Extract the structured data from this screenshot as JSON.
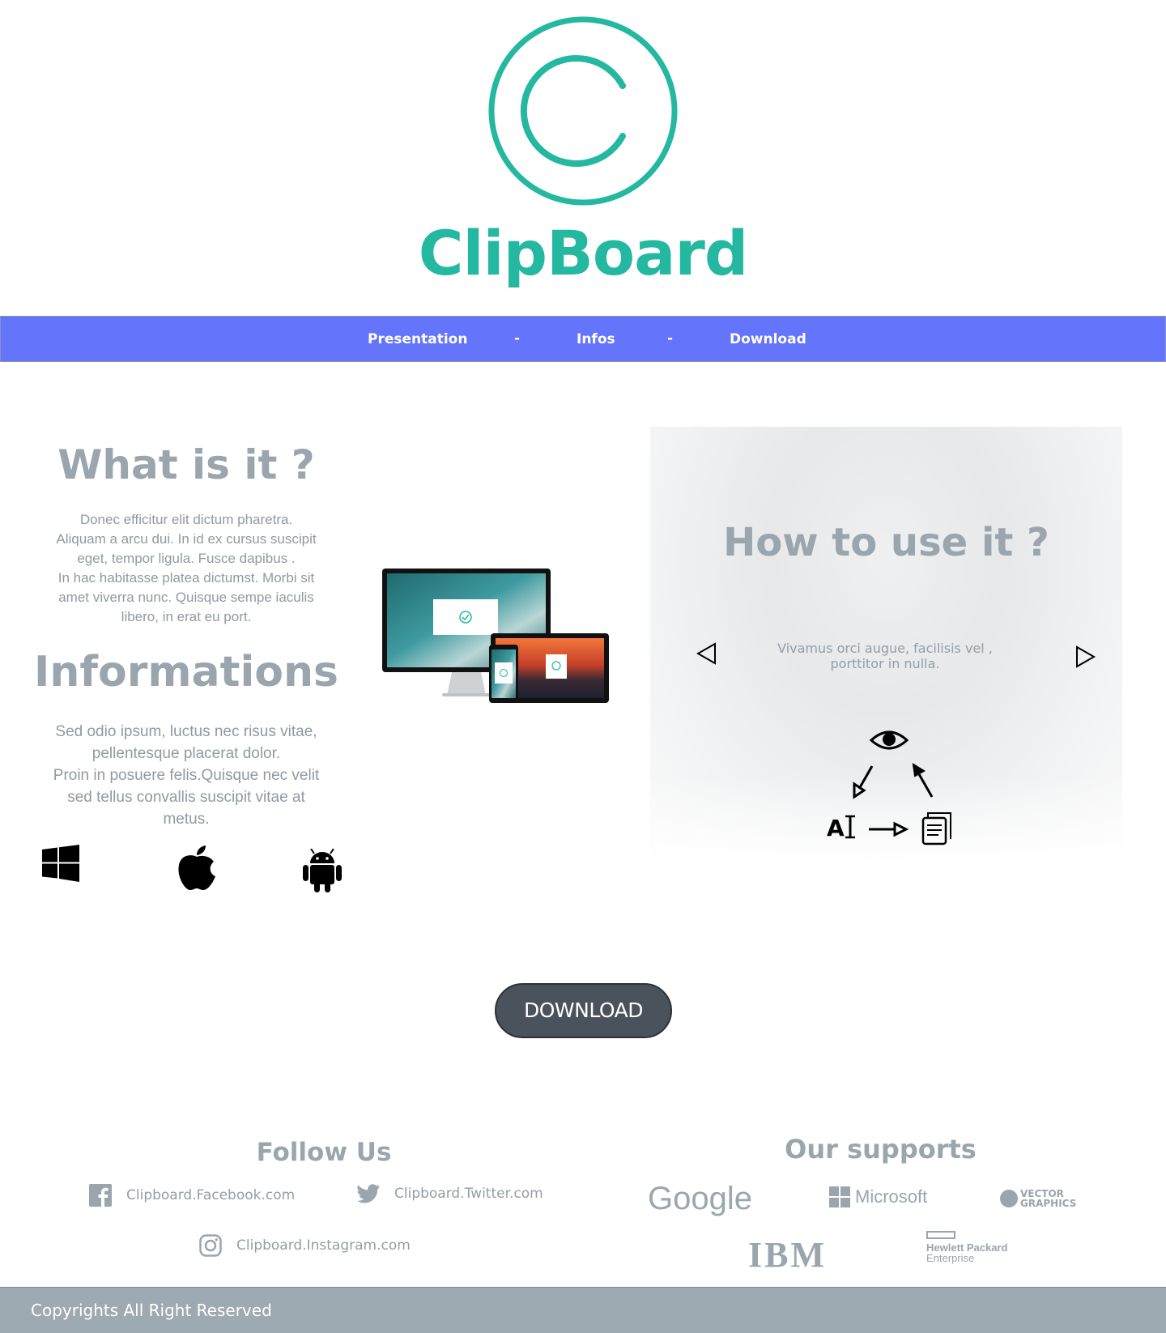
{
  "brand": {
    "name": "ClipBoard",
    "logo_icon": "copyright-icon",
    "color": "#24b8a0"
  },
  "nav": {
    "items": [
      {
        "label": "Presentation"
      },
      {
        "label": "Infos"
      },
      {
        "label": "Download"
      }
    ],
    "separator": "-",
    "background": "#6474fb"
  },
  "what": {
    "title": "What is it ?",
    "lines": [
      "Donec efficitur elit dictum pharetra.",
      "Aliquam a arcu dui. In id ex cursus suscipit",
      "eget, tempor ligula. Fusce dapibus .",
      "In hac habitasse platea dictumst. Morbi sit",
      "amet viverra nunc. Quisque sempe iaculis",
      "libero, in erat eu port."
    ]
  },
  "info": {
    "title": "Informations",
    "lines": [
      "Sed odio ipsum, luctus nec risus vitae,",
      "pellentesque placerat dolor.",
      "Proin in posuere felis.Quisque nec velit",
      "sed tellus convallis suscipit vitae at",
      "metus."
    ],
    "platforms": [
      "windows-icon",
      "apple-icon",
      "android-icon"
    ]
  },
  "how": {
    "title": "How to use it ?",
    "text_line1": "Vivamus orci augue, facilisis vel ,",
    "text_line2": "porttitor in nulla.",
    "flow_icons": [
      "eye-icon",
      "text-recognition-icon",
      "document-icon"
    ]
  },
  "download_button": {
    "label": "DOWNLOAD"
  },
  "follow": {
    "title": "Follow Us",
    "links": [
      {
        "label": "Clipboard.Facebook.com",
        "icon": "facebook-icon"
      },
      {
        "label": "Clipboard.Twitter.com",
        "icon": "twitter-icon"
      },
      {
        "label": "Clipboard.Instagram.com",
        "icon": "instagram-icon"
      }
    ]
  },
  "supports": {
    "title": "Our supports",
    "partners": [
      {
        "name": "Google"
      },
      {
        "name": "Microsoft"
      },
      {
        "name_line1": "VECTOR",
        "name_line2": "GRAPHICS"
      },
      {
        "name": "IBM"
      },
      {
        "name_line1": "Hewlett Packard",
        "name_line2": "Enterprise"
      }
    ]
  },
  "footer": {
    "text": "Copyrights All Right Reserved",
    "background": "#9eaab2"
  }
}
